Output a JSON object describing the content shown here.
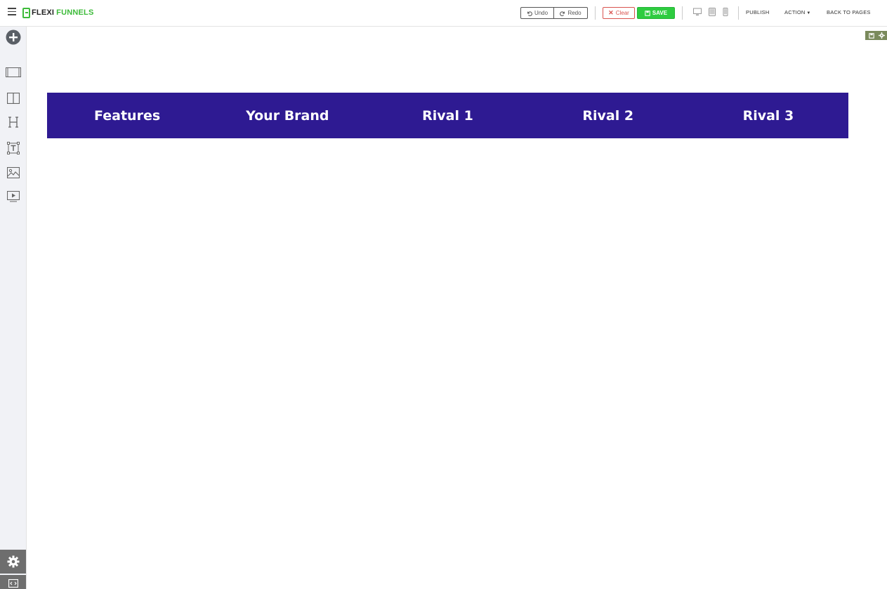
{
  "brand": {
    "name_part1": "FLEXI",
    "name_part2": "FUNNELS",
    "accent": "#3dbb3a"
  },
  "toolbar": {
    "undo_label": "Undo",
    "redo_label": "Redo",
    "clear_label": "Clear",
    "save_label": "SAVE",
    "publish_label": "PUBLISH",
    "action_label": "ACTION",
    "back_label": "BACK TO PAGES"
  },
  "sidebar": {
    "items": [
      {
        "name": "add-element",
        "icon": "plus-circle-icon"
      },
      {
        "name": "section",
        "icon": "section-icon"
      },
      {
        "name": "columns",
        "icon": "columns-icon"
      },
      {
        "name": "heading",
        "icon": "heading-icon"
      },
      {
        "name": "text",
        "icon": "text-icon"
      },
      {
        "name": "image",
        "icon": "image-icon"
      },
      {
        "name": "video",
        "icon": "video-icon"
      }
    ],
    "bottom": [
      {
        "name": "settings",
        "icon": "gear-icon"
      },
      {
        "name": "code",
        "icon": "code-icon"
      }
    ]
  },
  "table": {
    "header_bg": "#2e1a92",
    "columns": [
      "Features",
      "Your Brand",
      "Rival 1",
      "Rival 2",
      "Rival 3"
    ]
  }
}
